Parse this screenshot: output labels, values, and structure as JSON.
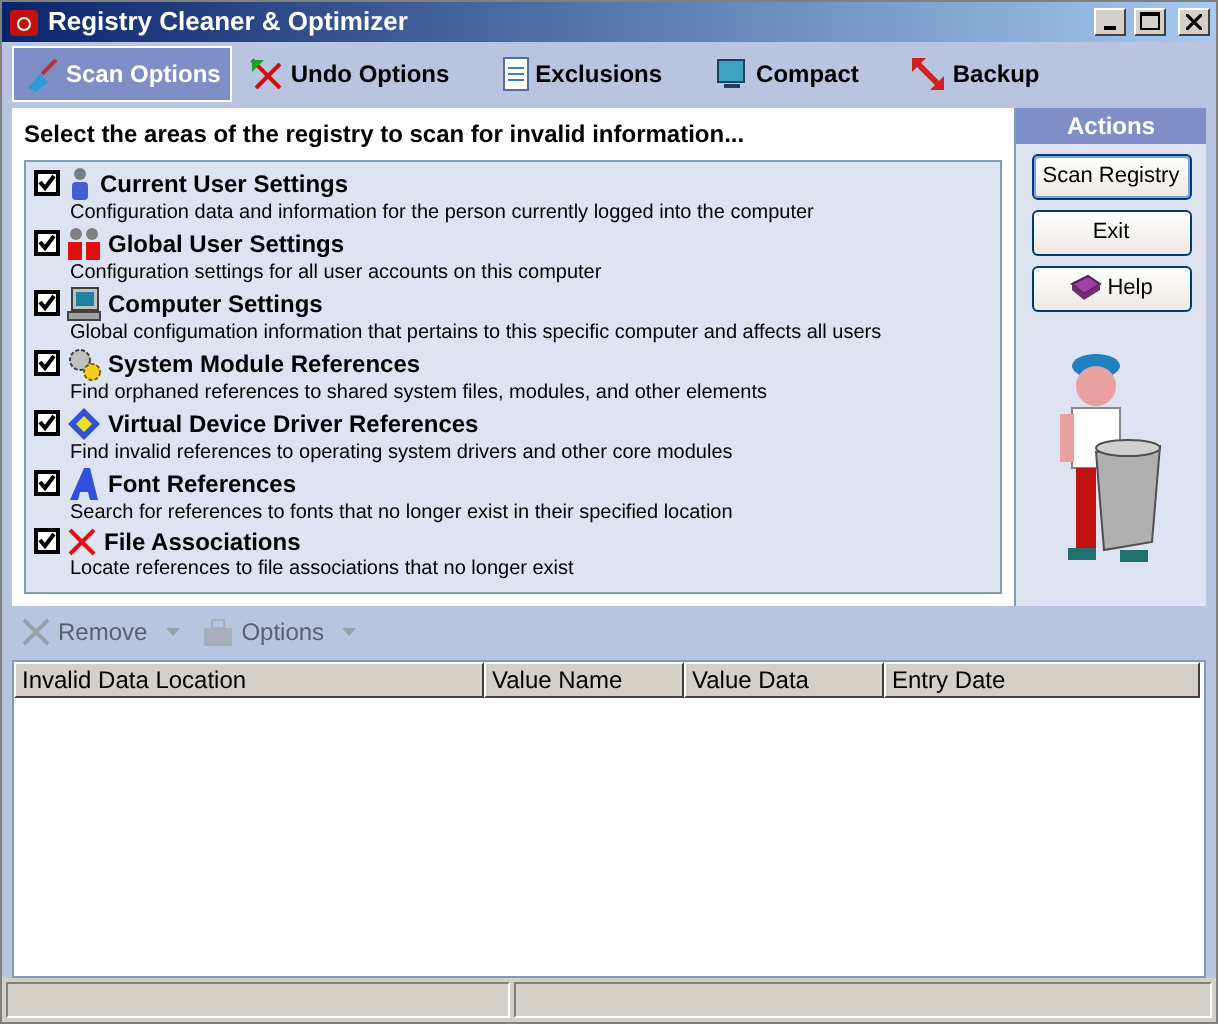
{
  "window": {
    "title": "Registry Cleaner & Optimizer"
  },
  "tabs": [
    {
      "label": "Scan Options",
      "selected": true
    },
    {
      "label": "Undo Options",
      "selected": false
    },
    {
      "label": "Exclusions",
      "selected": false
    },
    {
      "label": "Compact",
      "selected": false
    },
    {
      "label": "Backup",
      "selected": false
    }
  ],
  "scan": {
    "heading": "Select the areas of the registry to scan for invalid information...",
    "items": [
      {
        "title": "Current User Settings",
        "description": "Configuration data and information for the person currently logged into the computer",
        "checked": true
      },
      {
        "title": "Global User Settings",
        "description": "Configuration settings for all user accounts on this computer",
        "checked": true
      },
      {
        "title": "Computer Settings",
        "description": "Global configumation information that pertains to this specific computer and affects all users",
        "checked": true
      },
      {
        "title": "System Module References",
        "description": "Find orphaned references to shared system files, modules, and other elements",
        "checked": true
      },
      {
        "title": "Virtual Device Driver References",
        "description": "Find invalid references to operating system drivers and other core modules",
        "checked": true
      },
      {
        "title": "Font References",
        "description": "Search for references to fonts that no longer exist in their specified location",
        "checked": true
      },
      {
        "title": "File Associations",
        "description": "Locate references to file associations that no longer exist",
        "checked": true
      }
    ]
  },
  "actions": {
    "title": "Actions",
    "buttons": [
      {
        "label": "Scan Registry",
        "default": true
      },
      {
        "label": "Exit",
        "default": false
      },
      {
        "label": "Help",
        "default": false
      }
    ]
  },
  "results_toolbar": [
    {
      "label": "Remove",
      "disabled": true
    },
    {
      "label": "Options",
      "disabled": true
    }
  ],
  "table": {
    "columns": [
      "Invalid Data Location",
      "Value Name",
      "Value Data",
      "Entry Date"
    ]
  }
}
